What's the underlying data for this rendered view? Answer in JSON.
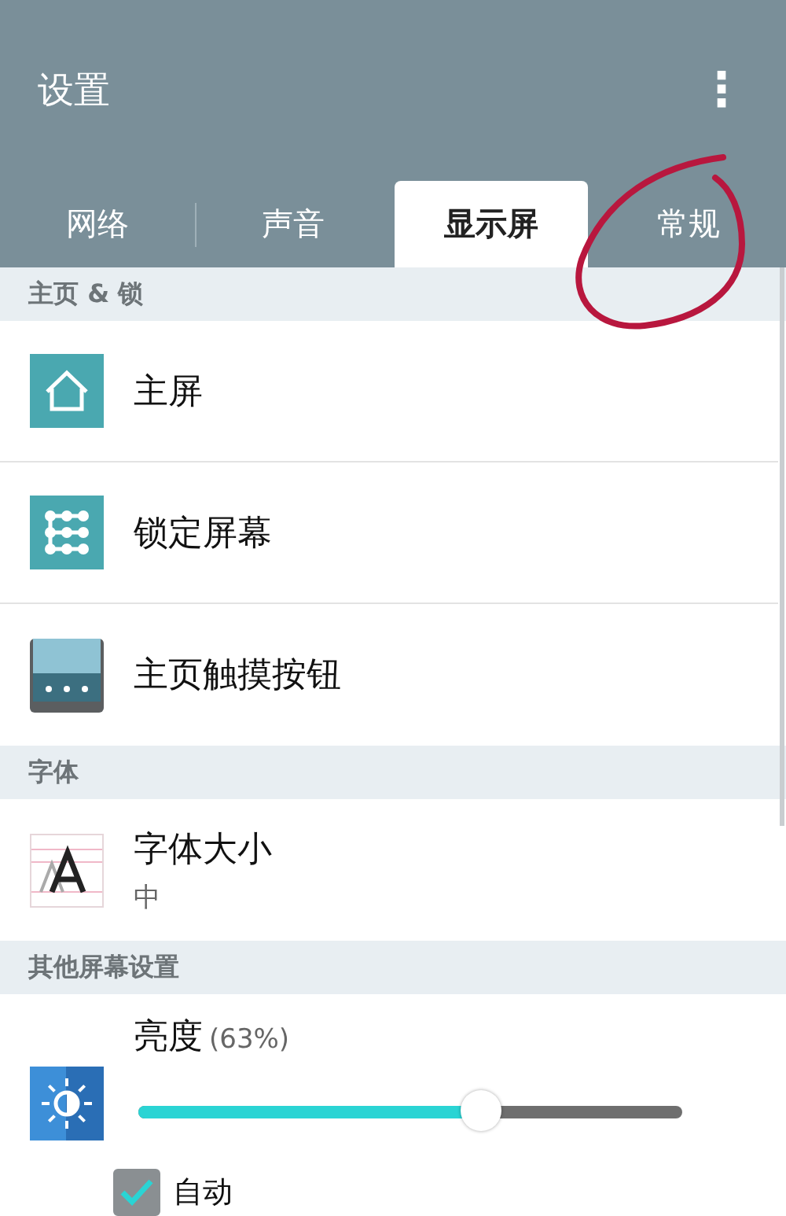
{
  "app_bar": {
    "title": "设置",
    "menu": "⋮"
  },
  "tabs": [
    {
      "label": "网络",
      "selected": false
    },
    {
      "label": "声音",
      "selected": false
    },
    {
      "label": "显示屏",
      "selected": true
    },
    {
      "label": "常规",
      "selected": false
    }
  ],
  "sections": [
    {
      "header": "主页 & 锁",
      "items": [
        {
          "kind": "home",
          "title": "主屏"
        },
        {
          "kind": "lock",
          "title": "锁定屏幕"
        },
        {
          "kind": "touch",
          "title": "主页触摸按钮"
        }
      ]
    },
    {
      "header": "字体",
      "items": [
        {
          "kind": "font",
          "title": "字体大小",
          "subtitle": "中"
        }
      ]
    },
    {
      "header": "其他屏幕设置",
      "items": [
        {
          "kind": "brightness",
          "title": "亮度",
          "reading": "(63%)",
          "level": 0.63,
          "auto": {
            "label": "自动",
            "checked": true
          }
        }
      ]
    }
  ]
}
